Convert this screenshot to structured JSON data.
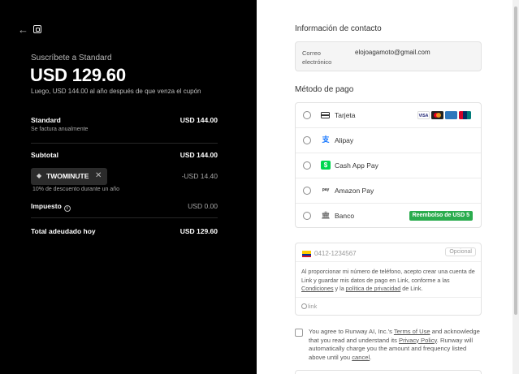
{
  "summary": {
    "subscribe_label": "Suscríbete a Standard",
    "price": "USD 129.60",
    "price_note": "Luego, USD 144.00 al año después de que venza el cupón",
    "plan_name": "Standard",
    "plan_price": "USD 144.00",
    "plan_billing": "Se factura anualmente",
    "subtotal_label": "Subtotal",
    "subtotal_value": "USD 144.00",
    "coupon_code": "TWOMINUTE",
    "coupon_value": "-USD 14.40",
    "coupon_note": "10% de descuento durante un año",
    "tax_label": "Impuesto",
    "tax_value": "USD 0.00",
    "total_label": "Total adeudado hoy",
    "total_value": "USD 129.60"
  },
  "contact": {
    "section_title": "Información de contacto",
    "email_label": "Correo electrónico",
    "email_value": "elojoagamoto@gmail.com"
  },
  "payment": {
    "section_title": "Método de pago",
    "methods": [
      {
        "label": "Tarjeta",
        "icon": "card-icon"
      },
      {
        "label": "Alipay",
        "icon": "alipay-icon"
      },
      {
        "label": "Cash App Pay",
        "icon": "cashapp-icon"
      },
      {
        "label": "Amazon Pay",
        "icon": "amazon-pay-icon"
      },
      {
        "label": "Banco",
        "icon": "bank-icon"
      }
    ],
    "card_brands": [
      "VISA",
      "",
      "",
      ""
    ],
    "bank_promo": "Reembolso de USD 5"
  },
  "link": {
    "phone_placeholder": "0412-1234567",
    "optional_label": "Opcional",
    "consent_1": "Al proporcionar mi número de teléfono, acepto crear una cuenta de Link y guardar mis datos de pago en Link, conforme a las ",
    "terms_link": "Condiciones",
    "consent_2": " y la ",
    "privacy_link": "política de privacidad",
    "consent_3": " de Link.",
    "logo_text": "link"
  },
  "terms": {
    "text_1": "You agree to Runway AI, Inc.'s ",
    "terms_of_use": "Terms of Use",
    "text_2": " and acknowledge that you read and understand its ",
    "privacy_policy": "Privacy Policy",
    "text_3": ". Runway will automatically charge you the amount and frequency listed above until you ",
    "cancel": "cancel",
    "text_4": "."
  },
  "colors": {
    "left_bg": "#000000",
    "promo_green": "#2bac4e",
    "cashapp_green": "#00d64f"
  }
}
